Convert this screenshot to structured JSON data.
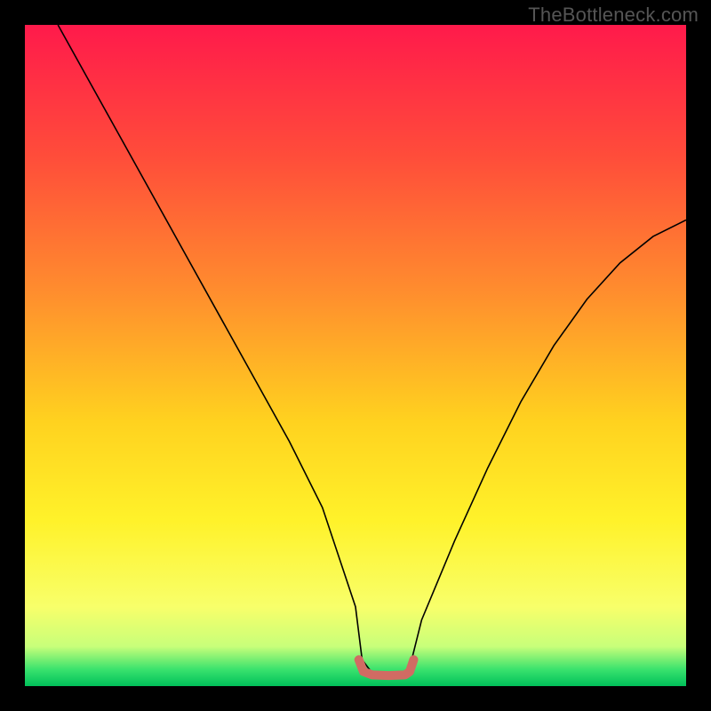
{
  "watermark": "TheBottleneck.com",
  "chart_data": {
    "type": "line",
    "title": "",
    "xlabel": "",
    "ylabel": "",
    "xlim": [
      0,
      100
    ],
    "ylim": [
      0,
      100
    ],
    "background_gradient": {
      "stops": [
        {
          "offset": 0.0,
          "color": "#ff1a4b"
        },
        {
          "offset": 0.2,
          "color": "#ff4d3a"
        },
        {
          "offset": 0.4,
          "color": "#ff8c2e"
        },
        {
          "offset": 0.6,
          "color": "#ffd21f"
        },
        {
          "offset": 0.75,
          "color": "#fff22a"
        },
        {
          "offset": 0.88,
          "color": "#f8ff6a"
        },
        {
          "offset": 0.94,
          "color": "#c8ff7a"
        },
        {
          "offset": 0.975,
          "color": "#39e26d"
        },
        {
          "offset": 1.0,
          "color": "#00c05a"
        }
      ]
    },
    "series": [
      {
        "name": "bottleneck-curve",
        "stroke": "#000000",
        "stroke_width": 1.6,
        "x": [
          5,
          10,
          15,
          20,
          25,
          30,
          35,
          40,
          45,
          50,
          51,
          52.5,
          55,
          57.5,
          58.5,
          60,
          65,
          70,
          75,
          80,
          85,
          90,
          95,
          100
        ],
        "y": [
          100,
          91,
          82,
          73,
          64,
          55,
          46,
          37,
          27,
          12,
          4,
          2,
          1.5,
          2,
          4,
          10,
          22,
          33,
          43,
          51.5,
          58.5,
          64,
          68,
          70.5
        ]
      },
      {
        "name": "optimal-range-marker",
        "stroke": "#d16b63",
        "stroke_width": 10,
        "linecap": "round",
        "x": [
          50.5,
          51.2,
          52.5,
          55,
          57.5,
          58.2,
          58.8
        ],
        "y": [
          4.0,
          2.2,
          1.7,
          1.6,
          1.7,
          2.2,
          4.0
        ]
      }
    ]
  }
}
